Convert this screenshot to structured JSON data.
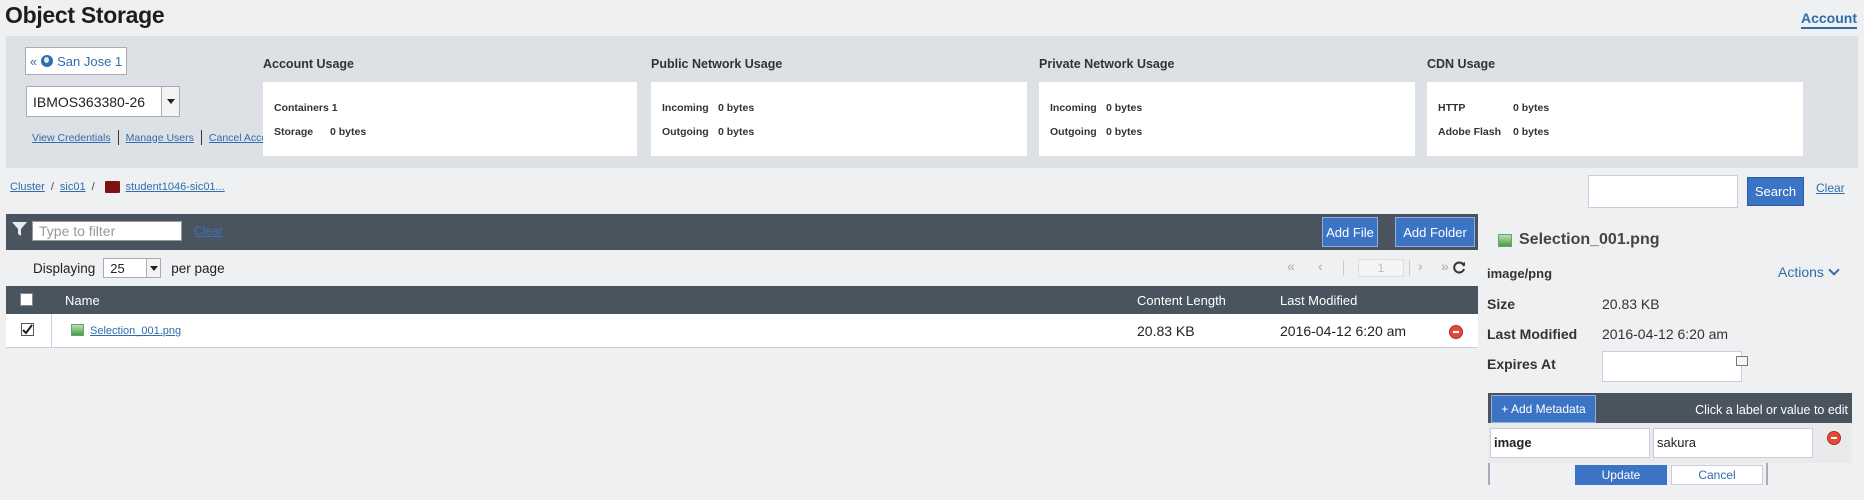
{
  "header": {
    "title": "Object Storage",
    "account_tab": "Account"
  },
  "account_panel": {
    "region_button": "San Jose 1",
    "account_select": "IBMOS363380-26",
    "links": [
      "View Credentials",
      "Manage Users",
      "Cancel Account"
    ]
  },
  "usage": {
    "account": {
      "title": "Account Usage",
      "rows": [
        {
          "label": "Containers",
          "value": "1"
        },
        {
          "label": "Storage",
          "value": "0 bytes"
        }
      ]
    },
    "public": {
      "title": "Public Network Usage",
      "rows": [
        {
          "label": "Incoming",
          "value": "0 bytes"
        },
        {
          "label": "Outgoing",
          "value": "0 bytes"
        }
      ]
    },
    "private": {
      "title": "Private Network Usage",
      "rows": [
        {
          "label": "Incoming",
          "value": "0 bytes"
        },
        {
          "label": "Outgoing",
          "value": "0 bytes"
        }
      ]
    },
    "cdn": {
      "title": "CDN Usage",
      "rows": [
        {
          "label": "HTTP",
          "value": "0 bytes"
        },
        {
          "label": "Adobe Flash",
          "value": "0 bytes"
        }
      ]
    }
  },
  "breadcrumb": [
    "Cluster",
    "sic01",
    "student1046-sic01..."
  ],
  "search": {
    "button": "Search",
    "clear": "Clear",
    "value": ""
  },
  "toolbar": {
    "filter_placeholder": "Type to filter",
    "clear": "Clear",
    "add_file": "Add File",
    "add_folder": "Add Folder"
  },
  "paging": {
    "displaying": "Displaying",
    "page_size": "25",
    "per_page": "per page",
    "page": "1"
  },
  "table": {
    "columns": [
      "Name",
      "Content Length",
      "Last Modified"
    ],
    "rows": [
      {
        "name": "Selection_001.png",
        "content_length": "20.83 KB",
        "last_modified": "2016-04-12 6:20 am",
        "checked": true
      }
    ]
  },
  "detail": {
    "title": "Selection_001.png",
    "content_type": "image/png",
    "actions": "Actions",
    "size_label": "Size",
    "size": "20.83 KB",
    "modified_label": "Last Modified",
    "modified": "2016-04-12 6:20 am",
    "expires_label": "Expires At",
    "expires": "",
    "add_metadata": "+ Add Metadata",
    "metadata_hint": "Click a label or value to edit",
    "metadata": [
      {
        "key": "image",
        "value": "sakura"
      }
    ],
    "update": "Update",
    "cancel": "Cancel"
  },
  "colors": {
    "accent": "#3b74c4",
    "toolbar": "#49545e",
    "link": "#2f6dac",
    "delete": "#e24a3b",
    "bucket": "#7b1412"
  }
}
